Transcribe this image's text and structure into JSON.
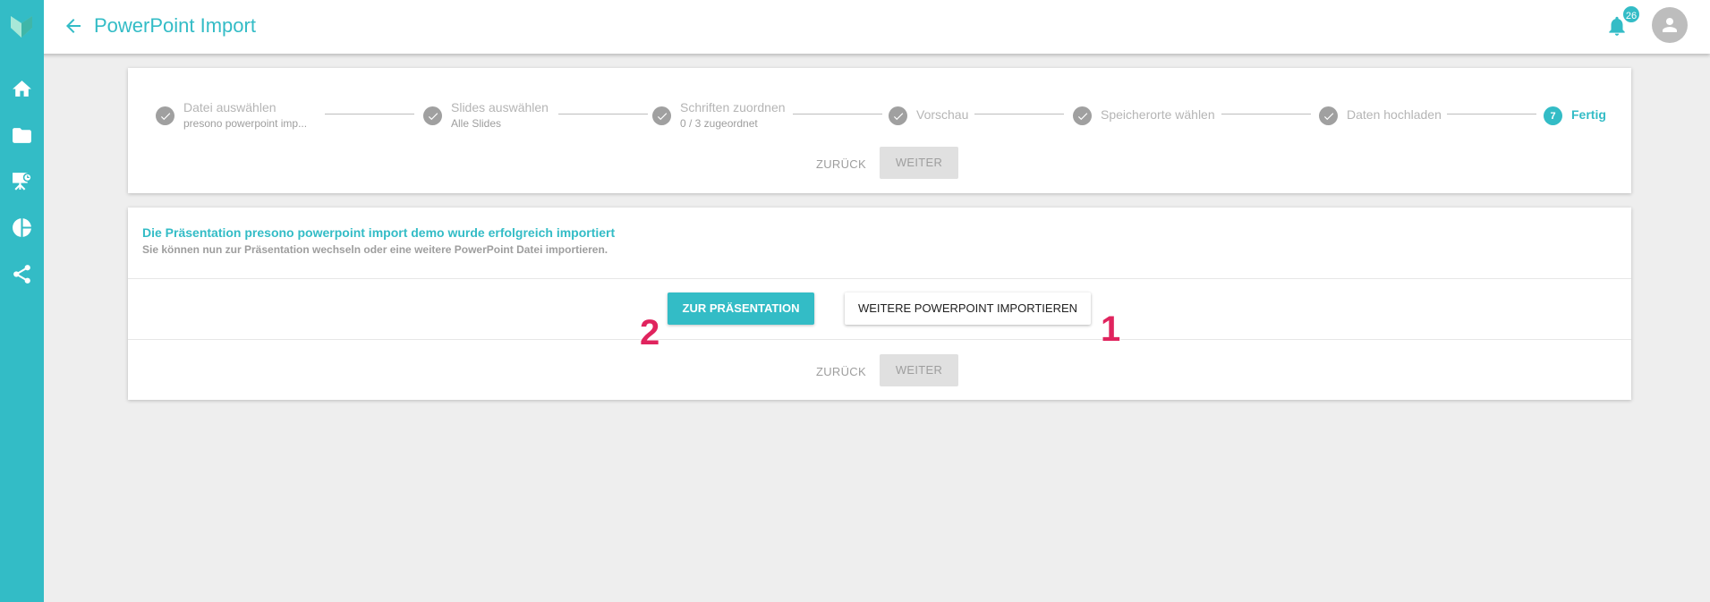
{
  "header": {
    "title": "PowerPoint Import",
    "notification_count": "26"
  },
  "sidebar": {
    "items": [
      {
        "icon": "home-icon"
      },
      {
        "icon": "folder-icon"
      },
      {
        "icon": "presentation-icon"
      },
      {
        "icon": "pie-chart-icon"
      },
      {
        "icon": "share-icon"
      }
    ]
  },
  "stepper": {
    "steps": [
      {
        "label": "Datei auswählen",
        "sub": "presono powerpoint imp..."
      },
      {
        "label": "Slides auswählen",
        "sub": "Alle Slides"
      },
      {
        "label": "Schriften zuordnen",
        "sub": "0 / 3 zugeordnet"
      },
      {
        "label": "Vorschau",
        "sub": ""
      },
      {
        "label": "Speicherorte wählen",
        "sub": ""
      },
      {
        "label": "Daten hochladen",
        "sub": ""
      },
      {
        "label": "Fertig",
        "sub": "",
        "number": "7"
      }
    ],
    "back_label": "ZURÜCK",
    "next_label": "WEITER"
  },
  "result": {
    "title": "Die Präsentation presono powerpoint import demo wurde erfolgreich importiert",
    "subtitle": "Sie können nun zur Präsentation wechseln oder eine weitere PowerPoint Datei importieren.",
    "primary_label": "ZUR PRÄSENTATION",
    "secondary_label": "WEITERE POWERPOINT IMPORTIEREN",
    "back_label": "ZURÜCK",
    "next_label": "WEITER"
  },
  "annotations": {
    "left": "2",
    "right": "1"
  },
  "colors": {
    "accent": "#33bcc6",
    "annotation": "#e0245e"
  }
}
